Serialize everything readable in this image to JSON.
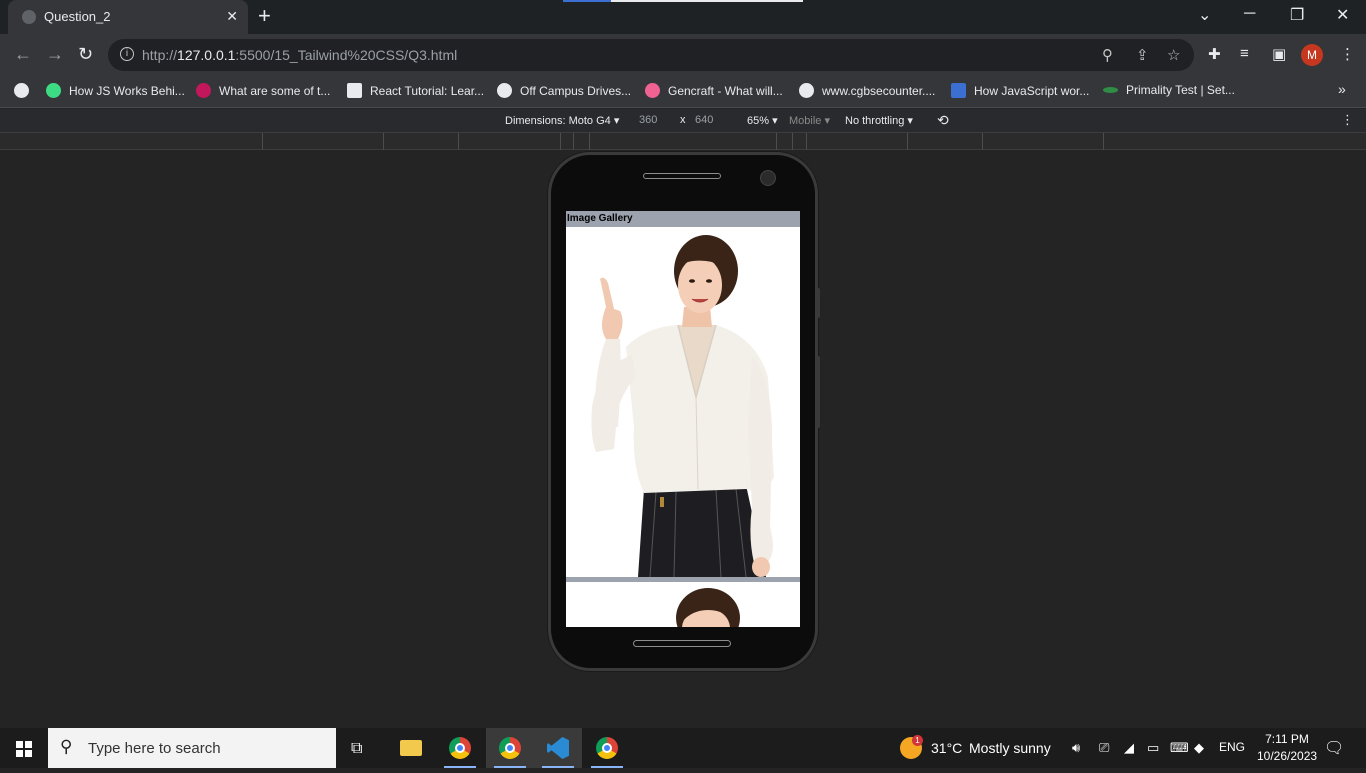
{
  "browser": {
    "tab_title": "Question_2",
    "tab_close": "✕",
    "new_tab": "+",
    "url_prefix": "http://",
    "url_host": "127.0.0.1",
    "url_rest": ":5500/15_Tailwind%20CSS/Q3.html"
  },
  "bookmarks": [
    {
      "label": "How JS Works Behi...",
      "color": "#3ddc84"
    },
    {
      "label": "What are some of t...",
      "color": "#c2185b"
    },
    {
      "label": "React Tutorial: Lear...",
      "color": "#e8eaed"
    },
    {
      "label": "Off Campus Drives...",
      "color": "#e8eaed"
    },
    {
      "label": "Gencraft - What will...",
      "color": "#f06292"
    },
    {
      "label": "www.cgbsecounter....",
      "color": "#e8eaed"
    },
    {
      "label": "How JavaScript wor...",
      "color": "#3b6fd1"
    },
    {
      "label": "Primality Test | Set...",
      "color": "#2f8d46"
    }
  ],
  "devtools": {
    "dimensions": "Dimensions: Moto G4 ▾",
    "width": "360",
    "times": "x",
    "height": "640",
    "zoom": "65% ▾",
    "mode": "Mobile ▾",
    "throttle": "No throttling ▾"
  },
  "page": {
    "header": "Image Gallery"
  },
  "taskbar": {
    "search_placeholder": "Type here to search",
    "temperature": "31°C",
    "weather": "Mostly sunny",
    "weather_badge": "1",
    "language": "ENG",
    "time": "7:11 PM",
    "date": "10/26/2023"
  }
}
